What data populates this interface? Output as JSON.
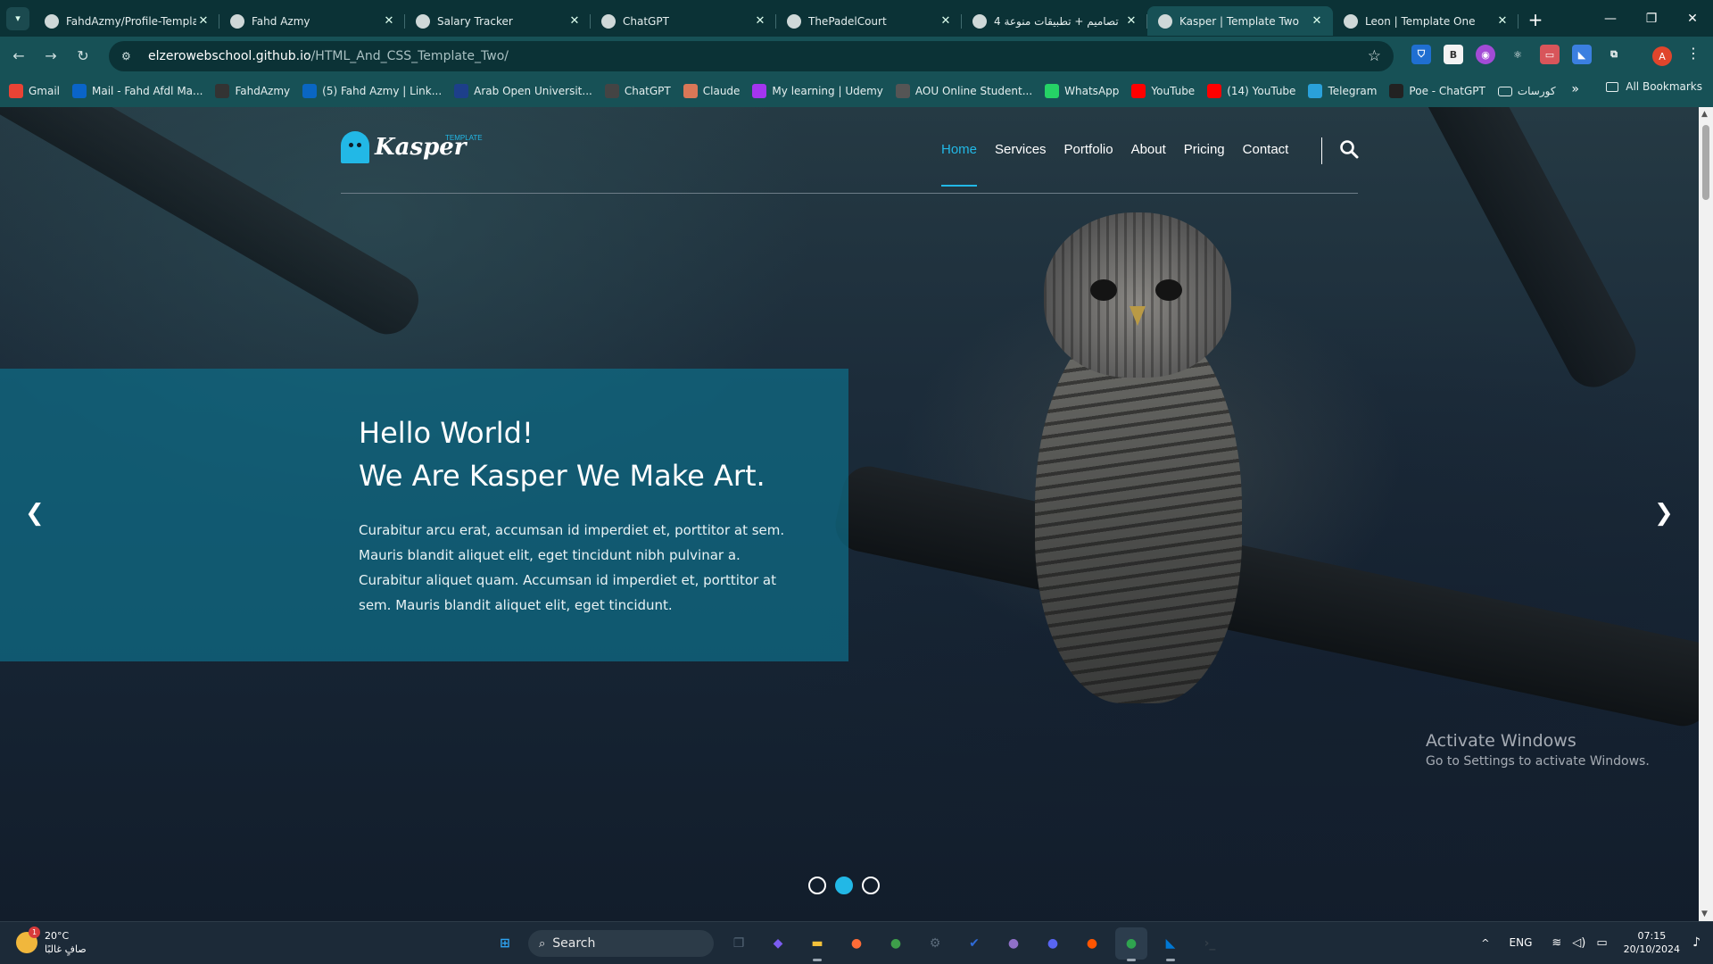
{
  "browser": {
    "tabs": [
      {
        "title": "FahdAzmy/Profile-Templa",
        "icon": "github-icon",
        "active": false
      },
      {
        "title": "Fahd Azmy",
        "icon": "avatar-icon",
        "active": false
      },
      {
        "title": "Salary Tracker",
        "icon": "globe-icon",
        "active": false
      },
      {
        "title": "ChatGPT",
        "icon": "chatgpt-icon",
        "active": false
      },
      {
        "title": "ThePadelCourt",
        "icon": "vite-icon",
        "active": false
      },
      {
        "title": "4 تصاميم + تطبيقات منوعة",
        "icon": "e-icon",
        "active": false
      },
      {
        "title": "Kasper | Template Two",
        "icon": "globe-icon",
        "active": true
      },
      {
        "title": "Leon | Template One",
        "icon": "globe-icon",
        "active": false
      }
    ],
    "new_tab_label": "+",
    "url": {
      "host": "elzerowebschool.github.io",
      "path": "/HTML_And_CSS_Template_Two/"
    },
    "profile_initial": "A",
    "bookmarks": [
      {
        "label": "Gmail",
        "icon": "gmail-icon",
        "color": "#ea4335"
      },
      {
        "label": "Mail - Fahd Afdl Ma...",
        "icon": "outlook-icon",
        "color": "#0a64c8"
      },
      {
        "label": "FahdAzmy",
        "icon": "github-icon",
        "color": "#333333"
      },
      {
        "label": "(5) Fahd Azmy | Link...",
        "icon": "linkedin-icon",
        "color": "#0a66c2"
      },
      {
        "label": "Arab Open Universit...",
        "icon": "aou-icon",
        "color": "#1d3f8a"
      },
      {
        "label": "ChatGPT",
        "icon": "chatgpt-icon",
        "color": "#444444"
      },
      {
        "label": "Claude",
        "icon": "claude-icon",
        "color": "#d97757"
      },
      {
        "label": "My learning | Udemy",
        "icon": "udemy-icon",
        "color": "#a435f0"
      },
      {
        "label": "AOU Online Student...",
        "icon": "globe-icon",
        "color": "#555555"
      },
      {
        "label": "WhatsApp",
        "icon": "whatsapp-icon",
        "color": "#25d366"
      },
      {
        "label": "YouTube",
        "icon": "youtube-icon",
        "color": "#ff0000"
      },
      {
        "label": "(14) YouTube",
        "icon": "youtube-icon",
        "color": "#ff0000"
      },
      {
        "label": "Telegram",
        "icon": "telegram-icon",
        "color": "#2aa1da"
      },
      {
        "label": "Poe - ChatGPT",
        "icon": "poe-icon",
        "color": "#222222"
      },
      {
        "label": "كورسات",
        "icon": "folder-icon",
        "color": "transparent"
      }
    ],
    "all_bookmarks_label": "All Bookmarks"
  },
  "site": {
    "logo_text": "Kasper",
    "logo_sub": "TEMPLATE",
    "nav": [
      {
        "label": "Home",
        "active": true
      },
      {
        "label": "Services",
        "active": false
      },
      {
        "label": "Portfolio",
        "active": false
      },
      {
        "label": "About",
        "active": false
      },
      {
        "label": "Pricing",
        "active": false
      },
      {
        "label": "Contact",
        "active": false
      }
    ],
    "hero": {
      "line1": "Hello World!",
      "line2": "We Are Kasper We Make Art.",
      "paragraph": "Curabitur arcu erat, accumsan id imperdiet et, porttitor at sem. Mauris blandit aliquet elit, eget tincidunt nibh pulvinar a. Curabitur aliquet quam. Accumsan id imperdiet et, porttitor at sem. Mauris blandit aliquet elit, eget tincidunt."
    },
    "slider_active_index": 1,
    "slider_count": 3,
    "accent": "#22b8e6"
  },
  "watermark": {
    "title": "Activate Windows",
    "subtitle": "Go to Settings to activate Windows."
  },
  "taskbar": {
    "weather": {
      "temp": "20°C",
      "desc": "صافٍ غالبًا",
      "badge": "1"
    },
    "search_label": "Search",
    "apps": [
      {
        "name": "start-button",
        "glyph": "⊞",
        "color": "#2ea3f2"
      },
      {
        "name": "search-box"
      },
      {
        "name": "task-view",
        "glyph": "❐",
        "color": "#556677"
      },
      {
        "name": "copilot",
        "glyph": "◆",
        "color": "#7b5cf0"
      },
      {
        "name": "file-explorer",
        "glyph": "▬",
        "color": "#f3c13a"
      },
      {
        "name": "postman",
        "glyph": "●",
        "color": "#ff6c37"
      },
      {
        "name": "mongodb",
        "glyph": "●",
        "color": "#3e9e4a"
      },
      {
        "name": "settings",
        "glyph": "⚙",
        "color": "#5a6a7a"
      },
      {
        "name": "todo",
        "glyph": "✔",
        "color": "#2f6bd8"
      },
      {
        "name": "github-desktop",
        "glyph": "●",
        "color": "#8f70c8"
      },
      {
        "name": "discord",
        "glyph": "●",
        "color": "#5865f2"
      },
      {
        "name": "soundcloud",
        "glyph": "●",
        "color": "#ff5500"
      },
      {
        "name": "chrome",
        "glyph": "●",
        "color": "#2fa44f"
      },
      {
        "name": "vscode",
        "glyph": "◣",
        "color": "#0078d4"
      },
      {
        "name": "terminal",
        "glyph": "›_",
        "color": "#333e48"
      }
    ],
    "lang": "ENG",
    "time": "07:15",
    "date": "20/10/2024"
  }
}
